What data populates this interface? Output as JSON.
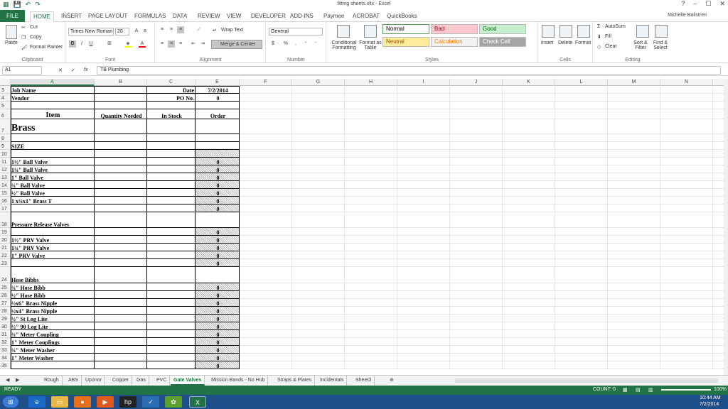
{
  "window": {
    "title": "fitting sheets.xltx - Excel",
    "user": "Michelle Balistreri",
    "controls": [
      "?",
      "–",
      "☐",
      "✕"
    ]
  },
  "tabs": [
    "FILE",
    "HOME",
    "INSERT",
    "PAGE LAYOUT",
    "FORMULAS",
    "DATA",
    "REVIEW",
    "VIEW",
    "DEVELOPER",
    "ADD-INS",
    "Paymee",
    "ACROBAT",
    "QuickBooks"
  ],
  "ribbon": {
    "clipboard": {
      "label": "Clipboard",
      "paste": "Paste",
      "cut": "Cut",
      "copy": "Copy",
      "format_painter": "Format Painter"
    },
    "font": {
      "label": "Font",
      "name": "Times New Roman",
      "size": "20"
    },
    "alignment": {
      "label": "Alignment",
      "wrap": "Wrap Text",
      "merge": "Merge & Center"
    },
    "number": {
      "label": "Number",
      "format": "General"
    },
    "styles": {
      "label": "Styles",
      "conditional": "Conditional Formatting",
      "format_table": "Format as Table",
      "cells": [
        {
          "name": "Normal",
          "bg": "#ffffff",
          "fg": "#000000"
        },
        {
          "name": "Bad",
          "bg": "#ffc7ce",
          "fg": "#9c0006"
        },
        {
          "name": "Good",
          "bg": "#c6efce",
          "fg": "#006100"
        },
        {
          "name": "Neutral",
          "bg": "#ffeb9c",
          "fg": "#9c5700"
        },
        {
          "name": "Calculation",
          "bg": "#f2f2f2",
          "fg": "#fa7d00"
        },
        {
          "name": "Check Cell",
          "bg": "#a5a5a5",
          "fg": "#ffffff"
        }
      ]
    },
    "cells": {
      "label": "Cells",
      "insert": "Insert",
      "delete": "Delete",
      "format": "Format"
    },
    "editing": {
      "label": "Editing",
      "autosum": "AutoSum",
      "fill": "Fill",
      "clear": "Clear",
      "sort": "Sort & Filter",
      "find": "Find & Select"
    }
  },
  "formula_bar": {
    "name_box": "A1",
    "formula": "TB Plumbing",
    "fx": "fx"
  },
  "columns": [
    "A",
    "B",
    "C",
    "E",
    "F",
    "G",
    "H",
    "I",
    "J",
    "K",
    "L",
    "M",
    "N"
  ],
  "sheet": {
    "job_name_label": "Job Name",
    "vendor_label": "Vendor",
    "date_label": "Date",
    "date_value": "7/2/2014",
    "po_label": "PO No.",
    "po_value": "0",
    "headers": {
      "item": "Item",
      "qty": "Quantity Needed",
      "stock": "In Stock",
      "order": "Order"
    },
    "brass": "Brass",
    "size": "SIZE",
    "rows": [
      {
        "row": "11",
        "item": "1½\" Ball Valve",
        "order": "0"
      },
      {
        "row": "12",
        "item": "1¼\" Ball Valve",
        "order": "0"
      },
      {
        "row": "13",
        "item": "1\" Ball Valve",
        "order": "0"
      },
      {
        "row": "14",
        "item": "¾\" Ball Valve",
        "order": "0"
      },
      {
        "row": "15",
        "item": "½\" Ball Valve",
        "order": "0"
      },
      {
        "row": "16",
        "item": "1 x¾x1\" Brass T",
        "order": "0"
      },
      {
        "row": "17",
        "item": "",
        "order": "0"
      }
    ],
    "prv_section": "Pressure Release Valves",
    "prv_rows": [
      {
        "row": "19",
        "item": "",
        "order": "0"
      },
      {
        "row": "20",
        "item": "1½\" PRV Valve",
        "order": "0"
      },
      {
        "row": "21",
        "item": "1¼\" PRV Valve",
        "order": "0"
      },
      {
        "row": "22",
        "item": "1\" PRV Valve",
        "order": "0"
      },
      {
        "row": "23",
        "item": "",
        "order": "0"
      }
    ],
    "hose_section": "Hose Bibbs",
    "hose_rows": [
      {
        "row": "25",
        "item": "¾\" Hose Bibb",
        "order": "0"
      },
      {
        "row": "26",
        "item": "½\" Hose Bibb",
        "order": "0"
      },
      {
        "row": "27",
        "item": "½x6\" Brass Nipple",
        "order": "0"
      },
      {
        "row": "28",
        "item": "½x4\" Brass Nipple",
        "order": "0"
      },
      {
        "row": "29",
        "item": "½\" St Log Lite",
        "order": "0"
      },
      {
        "row": "30",
        "item": "½\" 90 Log Lite",
        "order": "0"
      },
      {
        "row": "31",
        "item": "¾\" Meter Coupling",
        "order": "0"
      },
      {
        "row": "32",
        "item": "1\" Meter Couplings",
        "order": "0"
      },
      {
        "row": "33",
        "item": "¾\" Meter Washer",
        "order": "0"
      },
      {
        "row": "34",
        "item": "1\" Meter Washer",
        "order": "0"
      },
      {
        "row": "35",
        "item": "",
        "order": "0"
      }
    ]
  },
  "sheet_tabs": [
    "Rough",
    "ABS",
    "Uponor",
    "Copper",
    "Gas",
    "PVC",
    "Gate Valves",
    "Mission Bands - No Hub",
    "Straps & Plates",
    "Incidentals",
    "Sheet3"
  ],
  "active_sheet": "Gate Valves",
  "status": {
    "ready": "READY",
    "count": "COUNT: 0",
    "zoom": "100%"
  },
  "clock": {
    "time": "10:44 AM",
    "date": "7/2/2014"
  }
}
